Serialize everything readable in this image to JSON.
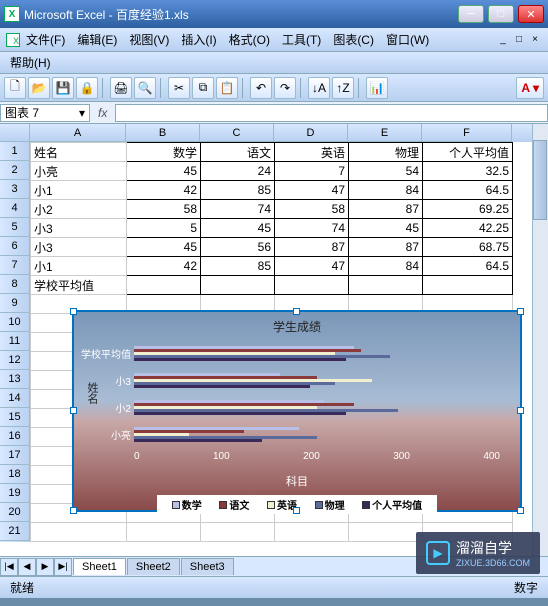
{
  "window": {
    "app": "Microsoft Excel",
    "doc": "百度经验1.xls",
    "title": "Microsoft Excel - 百度经验1.xls"
  },
  "menus": {
    "file": "文件(F)",
    "edit": "编辑(E)",
    "view": "视图(V)",
    "insert": "插入(I)",
    "format": "格式(O)",
    "tools": "工具(T)",
    "chart": "图表(C)",
    "window": "窗口(W)",
    "help": "帮助(H)"
  },
  "namebox": "图表 7",
  "columns": [
    "A",
    "B",
    "C",
    "D",
    "E",
    "F"
  ],
  "header_row": [
    "姓名",
    "数学",
    "语文",
    "英语",
    "物理",
    "个人平均值"
  ],
  "data_rows": [
    [
      "小亮",
      45,
      24,
      7,
      54,
      32.5
    ],
    [
      "小1",
      42,
      85,
      47,
      84,
      64.5
    ],
    [
      "小2",
      58,
      74,
      58,
      87,
      69.25
    ],
    [
      "小3",
      5,
      45,
      74,
      45,
      42.25
    ],
    [
      "小3",
      45,
      56,
      87,
      87,
      68.75
    ],
    [
      "小1",
      42,
      85,
      47,
      84,
      64.5
    ]
  ],
  "footer_label": "学校平均值",
  "chart_data": {
    "type": "bar",
    "title": "学生成绩",
    "ylabel": "姓名",
    "xlabel": "科目",
    "categories": [
      "小亮",
      "小2",
      "小3",
      "学校平均值"
    ],
    "x_ticks": [
      0,
      100,
      200,
      300,
      400
    ],
    "legend": [
      "数学",
      "语文",
      "英语",
      "物理",
      "个人平均值"
    ],
    "legend_colors": [
      "#b8c0e8",
      "#8a3a3a",
      "#f0f0d0",
      "#5a6a9a",
      "#3a2a5a"
    ]
  },
  "tabs": {
    "sheet1": "Sheet1",
    "sheet2": "Sheet2",
    "sheet3": "Sheet3"
  },
  "status": {
    "ready": "就绪",
    "mode": "数字"
  },
  "watermark": {
    "brand": "溜溜自学",
    "url": "ZIXUE.3D66.COM"
  }
}
